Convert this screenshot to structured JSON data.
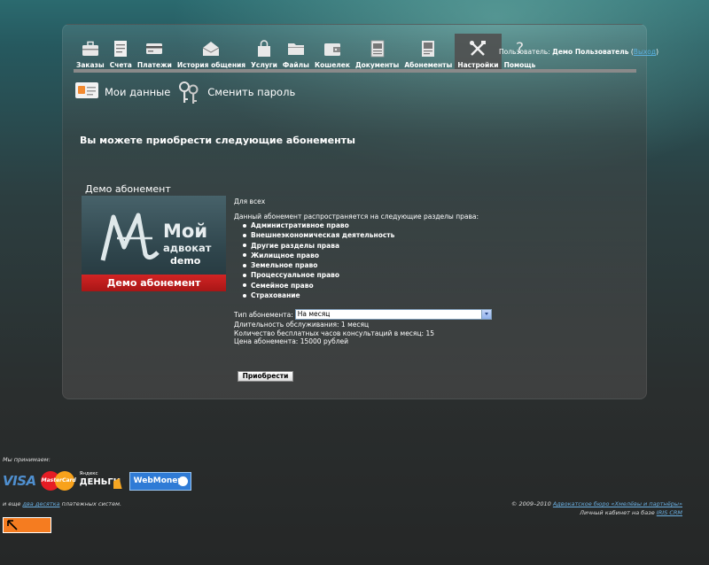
{
  "nav": {
    "items": [
      {
        "label": "Заказы",
        "icon": "briefcase-icon"
      },
      {
        "label": "Счета",
        "icon": "invoice-icon"
      },
      {
        "label": "Платежи",
        "icon": "card-icon"
      },
      {
        "label": "История общения",
        "icon": "envelope-icon"
      },
      {
        "label": "Услуги",
        "icon": "bag-icon"
      },
      {
        "label": "Файлы",
        "icon": "folder-icon"
      },
      {
        "label": "Кошелек",
        "icon": "wallet-icon"
      },
      {
        "label": "Документы",
        "icon": "document-icon"
      },
      {
        "label": "Абонементы",
        "icon": "subscription-icon"
      },
      {
        "label": "Настройки",
        "icon": "tools-icon",
        "active": true
      },
      {
        "label": "Помощь",
        "icon": "help-icon"
      }
    ]
  },
  "user": {
    "prefix": "Пользователь:",
    "name": "Демо Пользователь",
    "open_paren": "(",
    "logout_label": "Выход",
    "close_paren": ")"
  },
  "sub_links": {
    "my_data": "Мои данные",
    "change_password": "Сменить пароль"
  },
  "main": {
    "heading": "Вы можете приобрести следующие абонементы"
  },
  "subscription": {
    "title": "Демо абонемент",
    "banner": {
      "word1": "Мой",
      "word2": "адвокат",
      "word3": "demo",
      "band": "Демо абонемент"
    },
    "for_all": "Для всех",
    "covers_text": "Данный абонемент распространяется на следующие разделы права:",
    "areas": [
      "Административное право",
      "Внешнеэкономическая деятельность",
      "Другие разделы права",
      "Жилищное право",
      "Земельное право",
      "Процессуальное право",
      "Семейное право",
      "Страхование"
    ],
    "type_label": "Тип абонемента:",
    "type_value": "На месяц",
    "duration": "Длительность обслуживания: 1 месяц",
    "free_hours": "Количество бесплатных часов консультаций в месяц: 15",
    "price": "Цена абонемента: 15000 рублей",
    "buy_label": "Приобрести"
  },
  "footer": {
    "accept": "Мы принимаем:",
    "visa": "VISA",
    "mastercard": "MasterCard",
    "yandex_top": "Яндекс",
    "yandex_bottom": "ДЕНЬГИ",
    "webmoney": "WebMoney",
    "and_more_prefix": "и еще ",
    "and_more_link": "два десятка",
    "and_more_suffix": " платежных систем.",
    "copyright_prefix": "© 2009–2010 ",
    "copyright_link": "Адвокатское бюро «Хмелёвы и партнёры»",
    "crm_prefix": "Личный кабинет на базе ",
    "crm_link": "IRIS CRM"
  },
  "colors": {
    "accent_orange": "#f57c20",
    "link_blue": "#5bb0e0",
    "banner_red": "#c81e1e"
  }
}
